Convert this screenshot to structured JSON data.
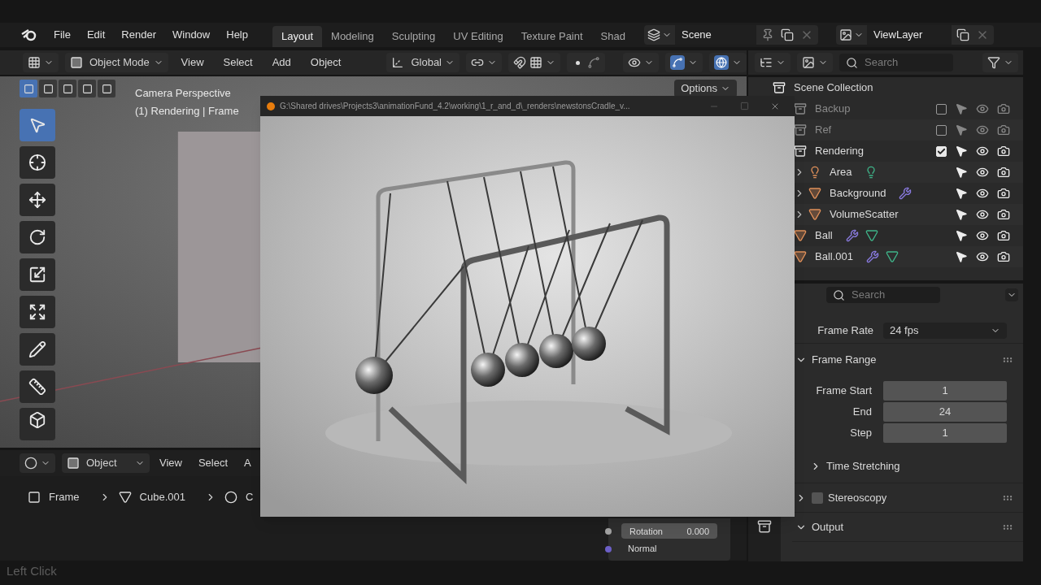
{
  "menubar": {
    "menus": [
      "File",
      "Edit",
      "Render",
      "Window",
      "Help"
    ]
  },
  "workspaces": [
    {
      "label": "Layout",
      "selected": true
    },
    {
      "label": "Modeling",
      "selected": false
    },
    {
      "label": "Sculpting",
      "selected": false
    },
    {
      "label": "UV Editing",
      "selected": false
    },
    {
      "label": "Texture Paint",
      "selected": false
    },
    {
      "label": "Shad",
      "selected": false
    }
  ],
  "scene_selector": {
    "value": "Scene"
  },
  "view_layer_selector": {
    "value": "ViewLayer"
  },
  "viewport_header": {
    "mode": "Object Mode",
    "menus": [
      "View",
      "Select",
      "Add",
      "Object"
    ],
    "orientation": "Global",
    "options": "Options"
  },
  "select_modes": [
    {
      "selected": true
    },
    {
      "selected": false
    },
    {
      "selected": false
    },
    {
      "selected": false
    },
    {
      "selected": false
    }
  ],
  "viewport": {
    "view_name": "Camera Perspective",
    "context": "(1) Rendering | Frame",
    "tools": [
      {
        "kind": "select",
        "selected": true
      },
      {
        "kind": "cursor",
        "selected": false
      },
      {
        "kind": "move",
        "selected": false
      },
      {
        "kind": "rotate",
        "selected": false
      },
      {
        "kind": "scale",
        "selected": false
      },
      {
        "kind": "transform",
        "selected": false
      },
      {
        "kind": "annotate",
        "selected": false
      },
      {
        "kind": "measure",
        "selected": false
      },
      {
        "kind": "add",
        "selected": false
      }
    ]
  },
  "node_editor": {
    "mode": "Object",
    "menus": [
      "View",
      "Select",
      "A"
    ],
    "breadcrumbs": [
      {
        "kind": "object",
        "label": "Frame"
      },
      {
        "kind": "mesh",
        "label": "Cube.001"
      },
      {
        "kind": "material",
        "label": "C"
      }
    ],
    "sockets": [
      {
        "kind": "field",
        "label": "Rotation",
        "value": "0.000",
        "color": "#a1a1a1"
      },
      {
        "kind": "output",
        "label": "Normal",
        "color": "#6c5fc7"
      }
    ]
  },
  "outliner": {
    "search": {
      "placeholder": "Search"
    },
    "title": "Scene Collection",
    "items": [
      {
        "name": "Backup",
        "kind": "collection",
        "enabled": false,
        "checked": false
      },
      {
        "name": "Ref",
        "kind": "collection",
        "enabled": false,
        "checked": false
      },
      {
        "name": "Rendering",
        "kind": "collection",
        "enabled": true,
        "checked": true,
        "children": [
          {
            "name": "Area",
            "kind": "light",
            "expanded": false,
            "badges": [
              {
                "kind": "light-data"
              }
            ]
          },
          {
            "name": "Background",
            "kind": "mesh",
            "expanded": false,
            "badges": [
              {
                "kind": "modifier"
              }
            ]
          },
          {
            "name": "VolumeScatter",
            "kind": "mesh",
            "expanded": false
          },
          {
            "name": "Ball",
            "kind": "mesh",
            "badges": [
              {
                "kind": "modifier"
              },
              {
                "kind": "mesh-data"
              }
            ]
          },
          {
            "name": "Ball.001",
            "kind": "mesh",
            "badges": [
              {
                "kind": "modifier"
              },
              {
                "kind": "mesh-data"
              }
            ]
          }
        ]
      }
    ]
  },
  "properties": {
    "search": {
      "placeholder": "Search"
    },
    "rows": [
      {
        "kind": "dropdown",
        "label": "Frame Rate",
        "value": "24 fps"
      }
    ],
    "panels": [
      {
        "title": "Frame Range",
        "expanded": true,
        "fields": [
          {
            "label": "Frame Start",
            "value": "1"
          },
          {
            "label": "End",
            "value": "24"
          },
          {
            "label": "Step",
            "value": "1"
          }
        ],
        "subpanels": [
          {
            "title": "Time Stretching",
            "expanded": false
          }
        ]
      },
      {
        "title": "Stereoscopy",
        "expanded": false,
        "checked": false
      },
      {
        "title": "Output",
        "expanded": true
      }
    ]
  },
  "render_window": {
    "title": "G:\\Shared drives\\Projects3\\animationFund_4.2\\working\\1_r_and_d\\_renders\\newstonsCradle_v..."
  },
  "status_bar": {
    "text": "Left Click"
  }
}
